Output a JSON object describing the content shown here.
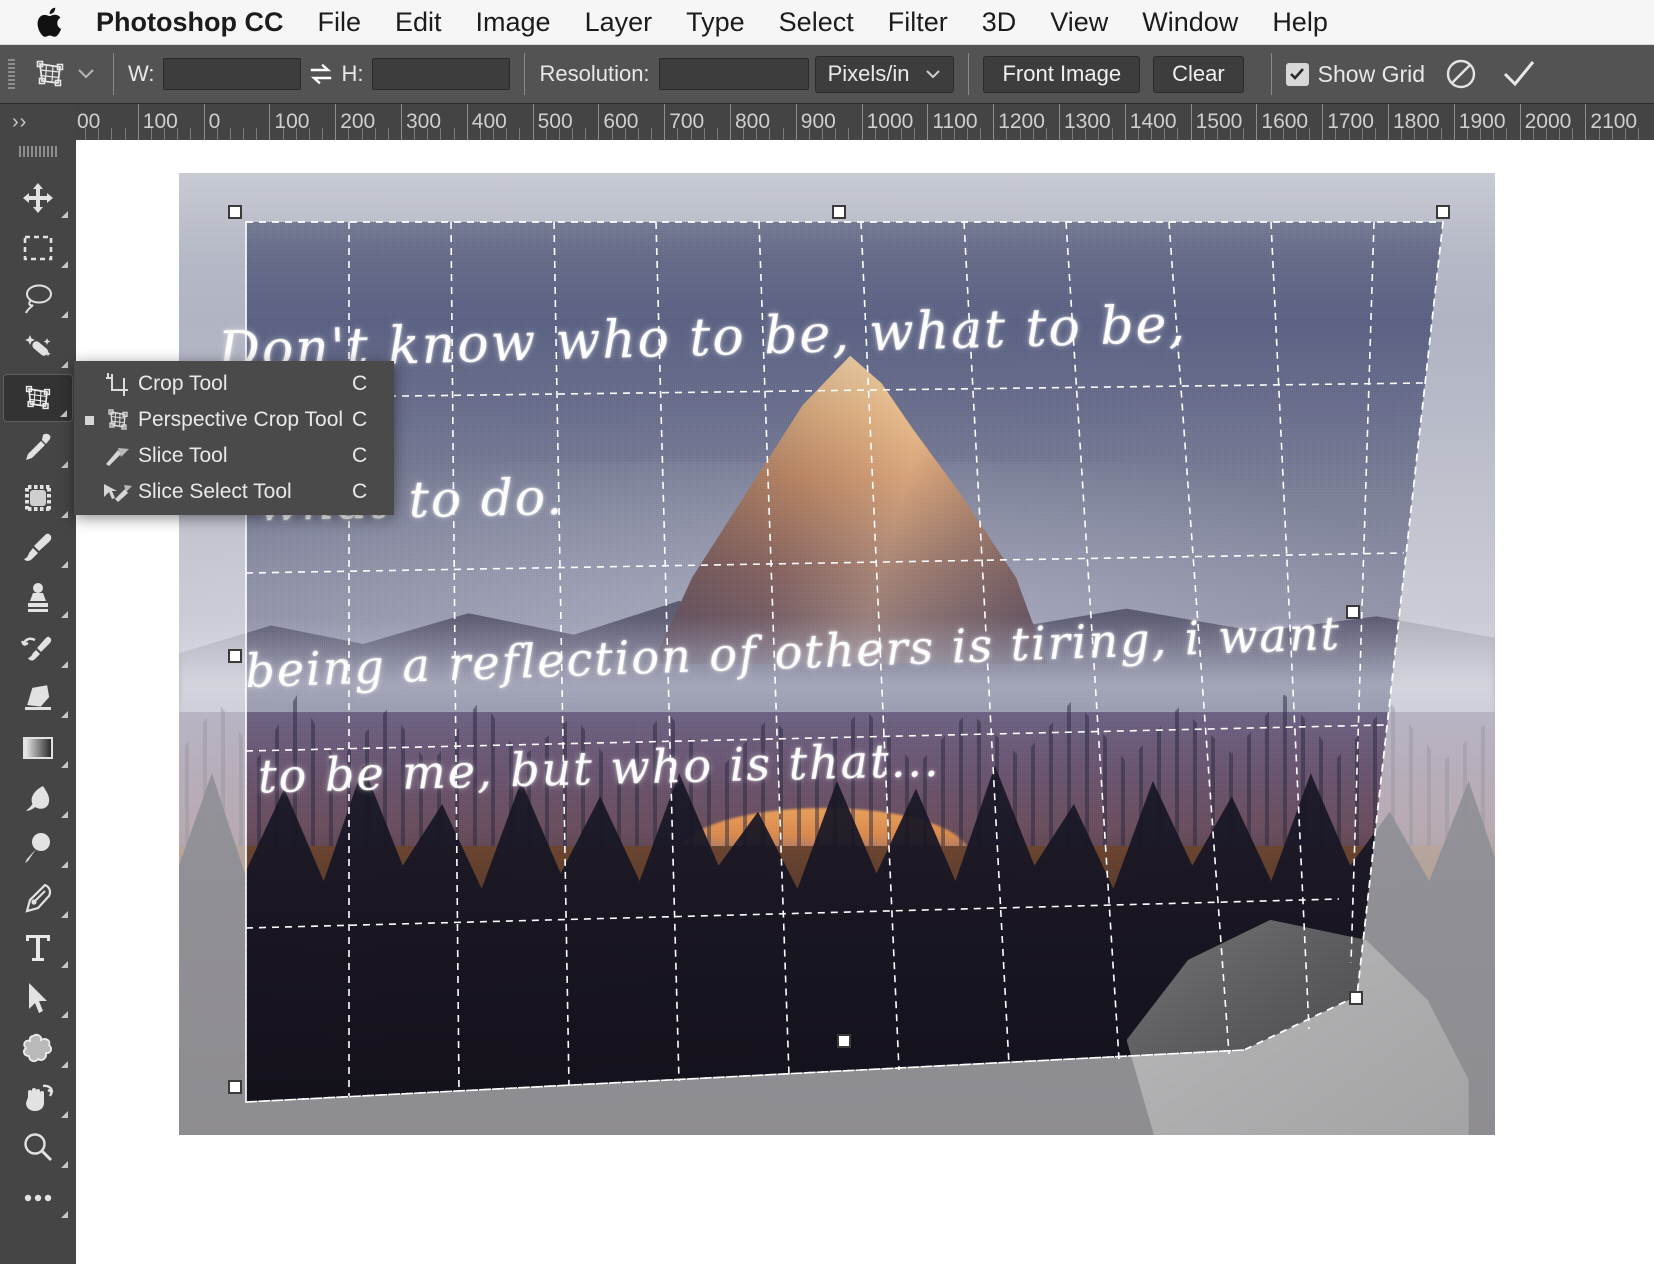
{
  "menubar": {
    "apple_icon": "apple-logo-icon",
    "items": [
      {
        "label": "Photoshop CC",
        "bold": true
      },
      {
        "label": "File"
      },
      {
        "label": "Edit"
      },
      {
        "label": "Image"
      },
      {
        "label": "Layer"
      },
      {
        "label": "Type"
      },
      {
        "label": "Select"
      },
      {
        "label": "Filter"
      },
      {
        "label": "3D"
      },
      {
        "label": "View"
      },
      {
        "label": "Window"
      },
      {
        "label": "Help"
      }
    ]
  },
  "options_bar": {
    "tool_icon": "perspective-crop-tool-icon",
    "preset_chevron": "chevron-down-icon",
    "width_label": "W:",
    "width_value": "",
    "swap_icon": "swap-arrows-icon",
    "height_label": "H:",
    "height_value": "",
    "resolution_label": "Resolution:",
    "resolution_value": "",
    "units_value": "Pixels/in",
    "units_chevron": "chevron-down-icon",
    "front_image_label": "Front Image",
    "clear_label": "Clear",
    "show_grid_label": "Show Grid",
    "show_grid_checked": true,
    "cancel_icon": "cancel-prohibited-icon",
    "commit_icon": "checkmark-icon"
  },
  "ruler": {
    "labels": [
      "00",
      "100",
      "0",
      "100",
      "200",
      "300",
      "400",
      "500",
      "600",
      "700",
      "800",
      "900",
      "1000",
      "1100",
      "1200",
      "1300",
      "1400",
      "1500",
      "1600",
      "1700",
      "1800",
      "1900",
      "2000",
      "2100"
    ]
  },
  "left_panel": {
    "expand_label": "››",
    "tools": [
      {
        "name": "move-tool",
        "icon": "move-arrows-icon"
      },
      {
        "name": "rectangular-marquee-tool",
        "icon": "dashed-rectangle-icon"
      },
      {
        "name": "lasso-tool",
        "icon": "lasso-icon"
      },
      {
        "name": "quick-selection-tool",
        "icon": "magic-wand-icon"
      },
      {
        "name": "perspective-crop-tool",
        "icon": "perspective-crop-icon",
        "active": true
      },
      {
        "name": "eyedropper-tool",
        "icon": "eyedropper-icon"
      },
      {
        "name": "patch-tool",
        "icon": "patch-icon"
      },
      {
        "name": "brush-tool",
        "icon": "paintbrush-icon"
      },
      {
        "name": "clone-stamp-tool",
        "icon": "clone-stamp-icon"
      },
      {
        "name": "history-brush-tool",
        "icon": "history-brush-icon"
      },
      {
        "name": "eraser-tool",
        "icon": "eraser-icon"
      },
      {
        "name": "gradient-tool",
        "icon": "gradient-icon"
      },
      {
        "name": "blur-tool",
        "icon": "blur-drop-icon"
      },
      {
        "name": "dodge-tool",
        "icon": "dodge-icon"
      },
      {
        "name": "pen-tool",
        "icon": "pen-nib-icon"
      },
      {
        "name": "type-tool",
        "icon": "text-t-icon"
      },
      {
        "name": "path-selection-tool",
        "icon": "arrow-cursor-icon"
      },
      {
        "name": "custom-shape-tool",
        "icon": "shape-blob-icon"
      },
      {
        "name": "hand-tool",
        "icon": "hand-rotate-icon"
      },
      {
        "name": "zoom-tool",
        "icon": "magnifier-icon"
      },
      {
        "name": "edit-toolbar",
        "icon": "ellipsis-icon"
      }
    ]
  },
  "flyout_menu": {
    "items": [
      {
        "label": "Crop Tool",
        "shortcut": "C",
        "icon": "crop-tool-icon",
        "selected": false
      },
      {
        "label": "Perspective Crop Tool",
        "shortcut": "C",
        "icon": "perspective-crop-tool-icon",
        "selected": true
      },
      {
        "label": "Slice Tool",
        "shortcut": "C",
        "icon": "slice-tool-icon",
        "selected": false
      },
      {
        "label": "Slice Select Tool",
        "shortcut": "C",
        "icon": "slice-select-tool-icon",
        "selected": false
      }
    ]
  },
  "canvas": {
    "handwriting_lines": [
      "Don't know who to be, what to be,",
      "what to do.",
      "being a reflection of others is tiring, i want",
      "to be me, but who is that..."
    ]
  },
  "colors": {
    "menubar_bg": "#f6f6f6",
    "options_bar_bg": "#535353",
    "ruler_bg": "#444444",
    "panel_bg": "#454545",
    "flyout_bg": "#4a4a4a",
    "active_tool_bg": "#333333",
    "text_light": "#e9e9e9",
    "canvas_bg": "#ffffff"
  }
}
